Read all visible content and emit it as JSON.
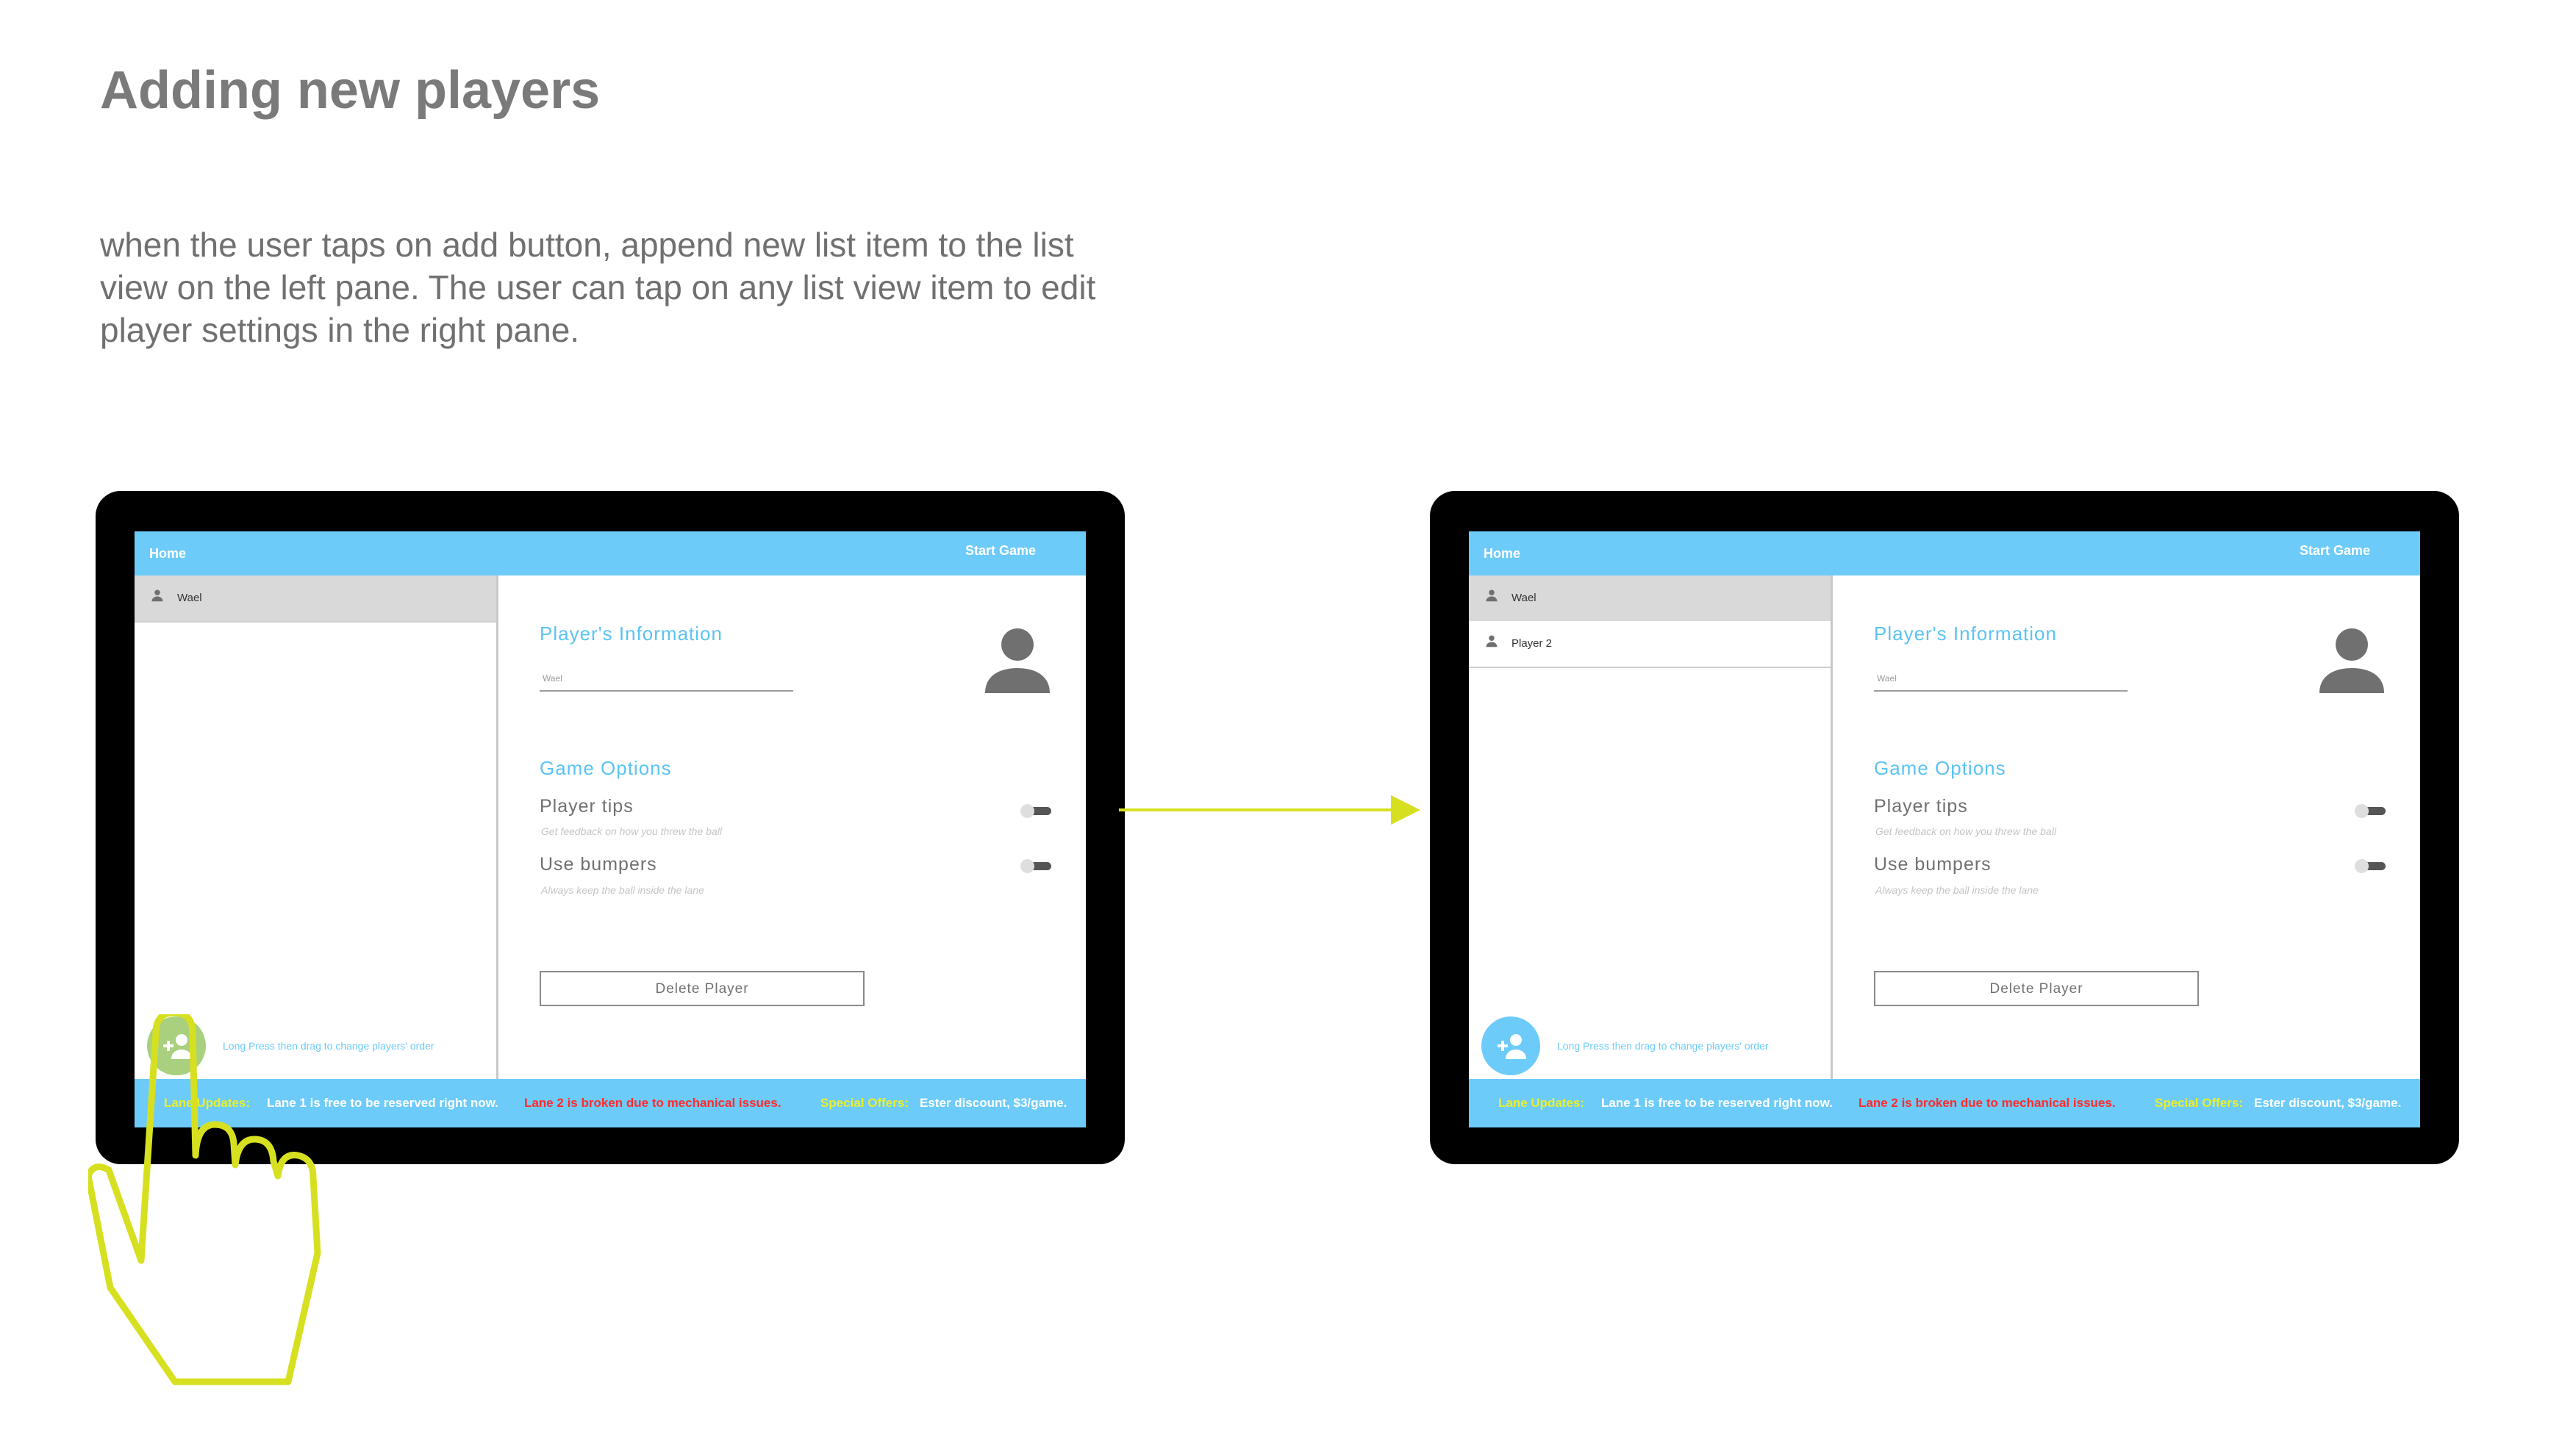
{
  "page": {
    "title": "Adding new players",
    "description_lines": [
      "when the user taps on add button, append new list item to the list",
      "view on the left pane.  The user can tap on any list view item to edit",
      "player settings in the right pane."
    ]
  },
  "colors": {
    "accent": "#6dcbf9",
    "highlight_yellow": "#e9ef2e",
    "alert_red": "#ff2b2b",
    "fab_pressed": "#a8d07e",
    "annotation_line": "#d7e020"
  },
  "before": {
    "topbar": {
      "home": "Home",
      "start_game": "Start Game"
    },
    "players": [
      {
        "name": "Wael",
        "icon": "person-icon"
      }
    ],
    "add_button": {
      "icon": "add-person-icon"
    },
    "hint": "Long Press then drag to change players' order",
    "details": {
      "player_info_title": "Player's Information",
      "name_value": "Wael",
      "avatar_icon": "account-icon",
      "game_options_title": "Game Options",
      "options": [
        {
          "label": "Player tips",
          "sub": "Get feedback on how you threw the ball"
        },
        {
          "label": "Use bumpers",
          "sub": "Always keep the ball inside the lane"
        }
      ],
      "delete_label": "Delete Player"
    },
    "ticker": {
      "lane_label": "Lane Updates:",
      "lane1": "Lane 1 is free to be reserved right now.",
      "lane2": "Lane 2 is broken due to mechanical issues.",
      "offers_label": "Special Offers:",
      "offer": "Ester discount, $3/game."
    }
  },
  "after": {
    "topbar": {
      "home": "Home",
      "start_game": "Start Game"
    },
    "players": [
      {
        "name": "Wael",
        "icon": "person-icon"
      },
      {
        "name": "Player 2",
        "icon": "person-icon"
      }
    ],
    "add_button": {
      "icon": "add-person-icon"
    },
    "hint": "Long Press then drag to change players' order",
    "details": {
      "player_info_title": "Player's Information",
      "name_value": "Wael",
      "avatar_icon": "account-icon",
      "game_options_title": "Game Options",
      "options": [
        {
          "label": "Player tips",
          "sub": "Get feedback on how you threw the ball"
        },
        {
          "label": "Use bumpers",
          "sub": "Always keep the ball inside the lane"
        }
      ],
      "delete_label": "Delete Player"
    },
    "ticker": {
      "lane_label": "Lane Updates:",
      "lane1": "Lane 1 is free to be reserved right now.",
      "lane2": "Lane 2 is broken due to mechanical issues.",
      "offers_label": "Special Offers:",
      "offer": "Ester discount, $3/game."
    }
  }
}
